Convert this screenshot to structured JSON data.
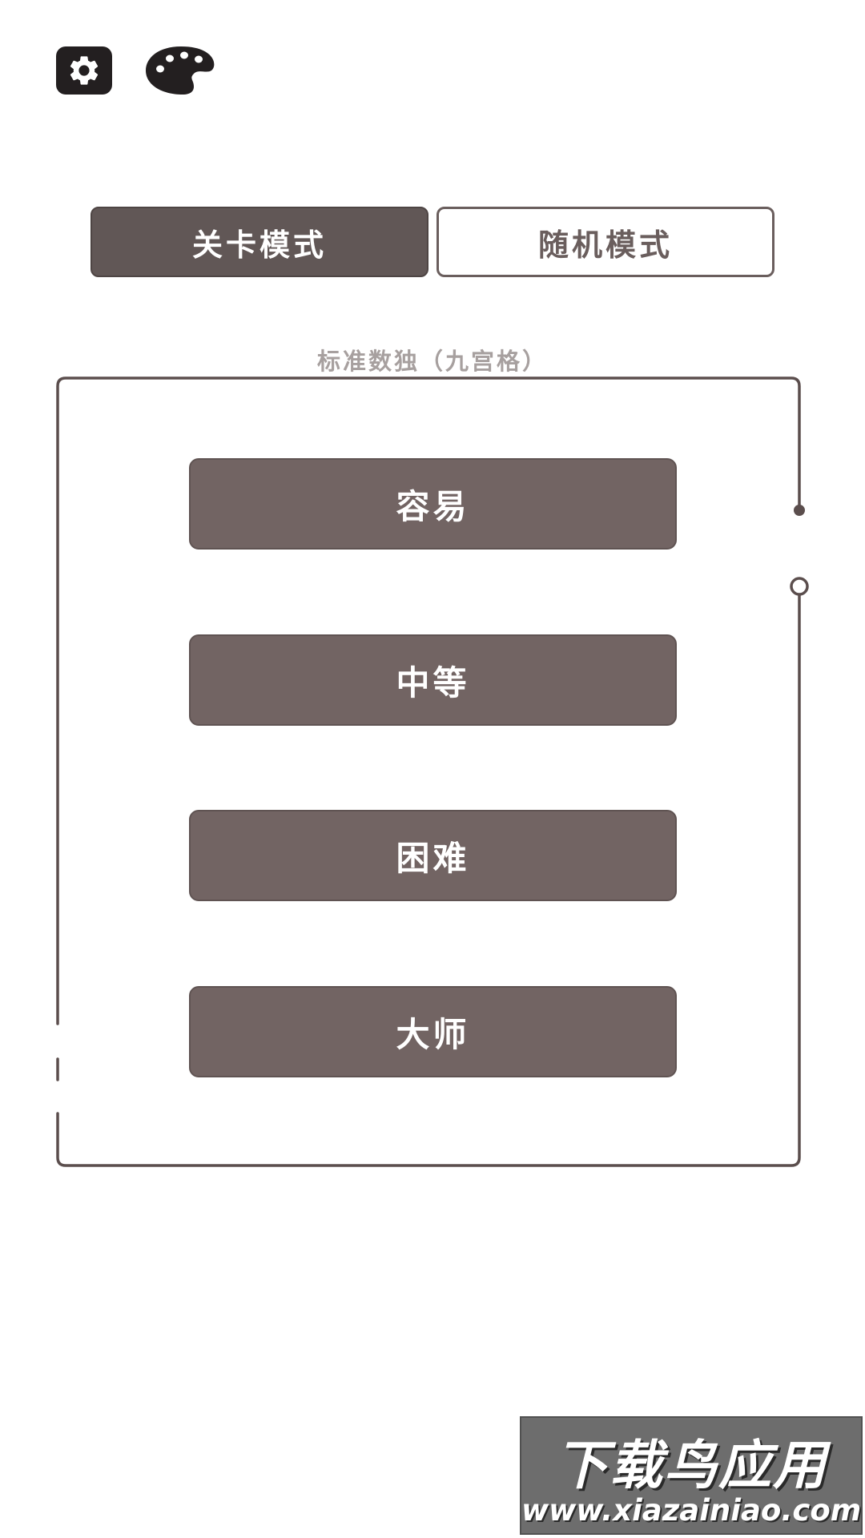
{
  "header": {
    "settings_icon": "gear-icon",
    "palette_icon": "palette-icon"
  },
  "tabs": [
    {
      "label": "关卡模式",
      "selected": true
    },
    {
      "label": "随机模式",
      "selected": false
    }
  ],
  "section": {
    "label": "标准数独（九宫格）"
  },
  "difficulties": [
    {
      "label": "容易"
    },
    {
      "label": "中等"
    },
    {
      "label": "困难"
    },
    {
      "label": "大师"
    }
  ],
  "watermark": {
    "title": "下载鸟应用",
    "url": "www.xiazainiao.com"
  },
  "colors": {
    "accent_dark": "#615756",
    "button_fill": "#726463",
    "frame_line": "#5b4e4d",
    "label_gray": "#a7a09f"
  }
}
